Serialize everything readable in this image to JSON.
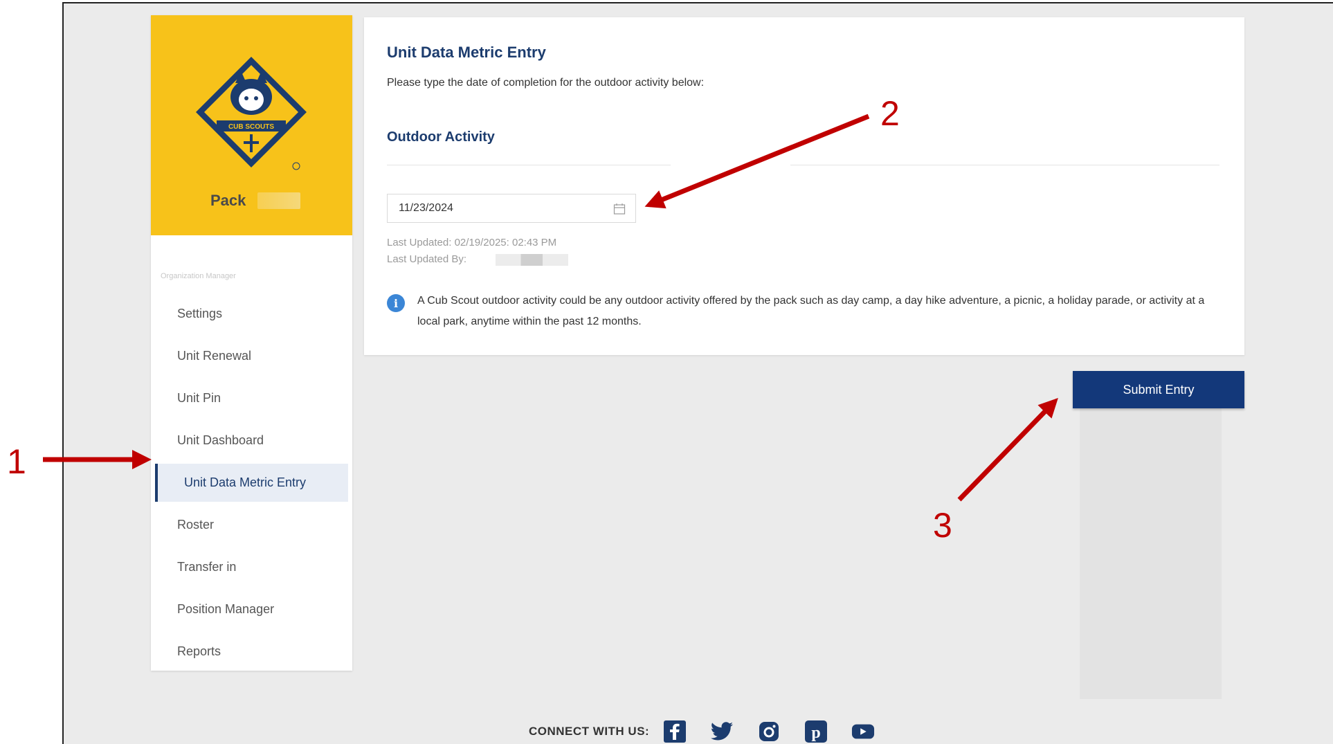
{
  "sidebar": {
    "pack_label": "Pack",
    "org_label": "Organization Manager",
    "items": [
      {
        "label": "Settings"
      },
      {
        "label": "Unit Renewal"
      },
      {
        "label": "Unit Pin"
      },
      {
        "label": "Unit Dashboard"
      },
      {
        "label": "Unit Data Metric Entry",
        "active": true
      },
      {
        "label": "Roster"
      },
      {
        "label": "Transfer in"
      },
      {
        "label": "Position Manager"
      },
      {
        "label": "Reports"
      }
    ]
  },
  "main": {
    "title": "Unit Data Metric Entry",
    "subtitle": "Please type the date of completion for the outdoor activity below:",
    "section_title": "Outdoor Activity",
    "date_value": "11/23/2024",
    "last_updated": "Last Updated: 02/19/2025: 02:43 PM",
    "last_updated_by": "Last Updated By:",
    "info_text": "A Cub Scout outdoor activity could be any outdoor activity offered by the pack such as day camp, a day hike adventure, a picnic, a holiday parade, or activity at a local park, anytime within the past 12 months.",
    "submit_label": "Submit Entry"
  },
  "footer": {
    "connect_label": "CONNECT WITH US:",
    "social_icons": [
      "facebook-icon",
      "twitter-icon",
      "instagram-icon",
      "pinterest-icon",
      "youtube-icon"
    ]
  },
  "annotations": {
    "one": "1",
    "two": "2",
    "three": "3",
    "arrow_color": "#c00000"
  },
  "colors": {
    "brand_yellow": "#f7c21a",
    "navy": "#13387a",
    "heading_blue": "#1c3c6e",
    "info_blue": "#3b86d6"
  },
  "logo_text": "CUB SCOUTS"
}
